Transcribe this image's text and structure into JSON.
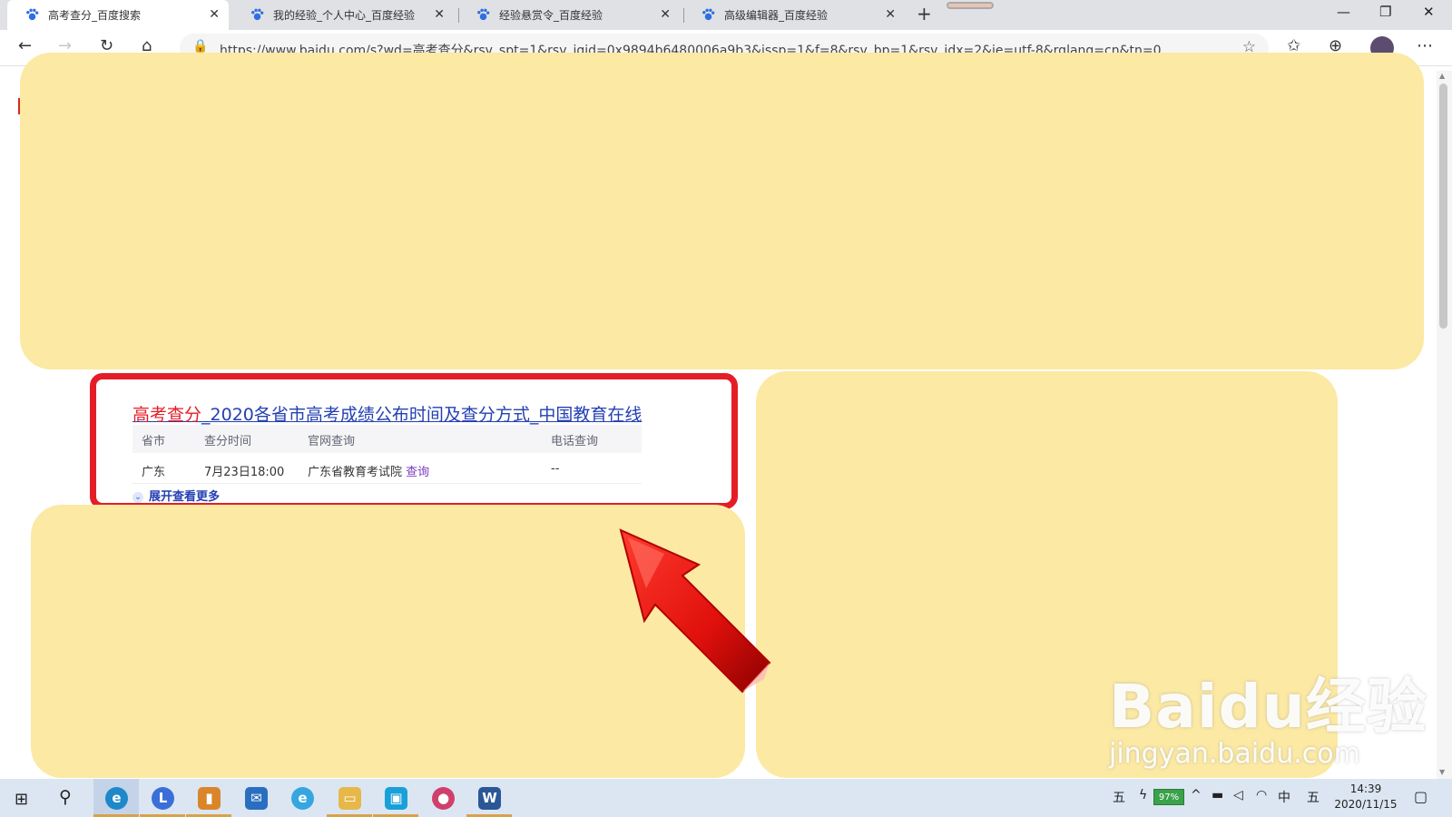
{
  "browser": {
    "tabs": [
      {
        "title": "高考查分_百度搜索",
        "active": true
      },
      {
        "title": "我的经验_个人中心_百度经验",
        "active": false
      },
      {
        "title": "经验悬赏令_百度经验",
        "active": false
      },
      {
        "title": "高级编辑器_百度经验",
        "active": false
      }
    ],
    "tab_close_glyph": "✕",
    "new_tab_glyph": "+",
    "window_controls": {
      "minimize": "—",
      "restore": "❐",
      "close": "✕"
    },
    "nav": {
      "back": "←",
      "forward": "→",
      "refresh": "↻",
      "home": "⌂"
    },
    "address": "https://www.baidu.com/s?wd=高考查分&rsv_spt=1&rsv_iqid=0x9894b6480006a9b3&issp=1&f=8&rsv_bp=1&rsv_idx=2&ie=utf-8&rqlang=cn&tn=0",
    "lock_glyph": "🔒",
    "favorite_glyph": "☆",
    "favorites_bar_glyph": "✩",
    "collections_glyph": "⊕",
    "more_glyph": "⋯"
  },
  "result": {
    "title_keyword": "高考查分",
    "title_rest": "_2020各省市高考成绩公布时间及查分方式_中国教育在线",
    "columns": [
      "省市",
      "查分时间",
      "官网查询",
      "电话查询"
    ],
    "rows": [
      {
        "province": "广东",
        "time": "7月23日18:00",
        "site": "广东省教育考试院",
        "link": "查询",
        "phone": "--"
      }
    ],
    "expand_label": "展开查看更多",
    "expand_glyph": "⌄"
  },
  "watermark": {
    "logo": "Baidu经验",
    "url": "jingyan.baidu.com"
  },
  "taskbar": {
    "start_glyph": "⊞",
    "search_glyph": "⚲",
    "apps": [
      {
        "name": "edge",
        "glyph": "e",
        "color": "#1e88c8"
      },
      {
        "name": "l-app",
        "glyph": "L",
        "color": "#3b6fd8"
      },
      {
        "name": "notes",
        "glyph": "▮",
        "color": "#d9862b"
      },
      {
        "name": "mail",
        "glyph": "✉",
        "color": "#2a6fbf"
      },
      {
        "name": "ie",
        "glyph": "e",
        "color": "#36a6e0"
      },
      {
        "name": "explorer",
        "glyph": "▭",
        "color": "#e6b84a"
      },
      {
        "name": "app-blue",
        "glyph": "▣",
        "color": "#1aa0d8"
      },
      {
        "name": "drop-app",
        "glyph": "●",
        "color": "#d0406c"
      },
      {
        "name": "word",
        "glyph": "W",
        "color": "#2b5797"
      }
    ],
    "tray": {
      "ime_left": "五",
      "battery_percent": "97%",
      "chevron": "^",
      "lang": "中",
      "ime_right": "五"
    },
    "time": "14:39",
    "date": "2020/11/15",
    "notification_glyph": "▢"
  }
}
